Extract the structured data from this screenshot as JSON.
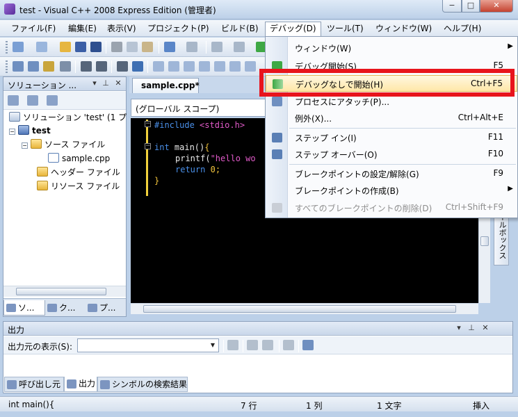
{
  "window": {
    "title": "test - Visual C++ 2008 Express Edition (管理者)",
    "minimize_glyph": "−",
    "maximize_glyph": "□",
    "close_glyph": "✕"
  },
  "menubar": {
    "items": [
      {
        "label": "ファイル(F)"
      },
      {
        "label": "編集(E)"
      },
      {
        "label": "表示(V)"
      },
      {
        "label": "プロジェクト(P)"
      },
      {
        "label": "ビルド(B)"
      },
      {
        "label": "デバッグ(D)"
      },
      {
        "label": "ツール(T)"
      },
      {
        "label": "ウィンドウ(W)"
      },
      {
        "label": "ヘルプ(H)"
      }
    ]
  },
  "solution_explorer": {
    "title": "ソリューション ...",
    "pin_glyph": "▾",
    "autohide_glyph": "⊥",
    "close_glyph": "✕",
    "tree": [
      {
        "label": "ソリューション 'test' (1 プ",
        "icon": "solution-icon"
      },
      {
        "label": "test",
        "icon": "project-icon",
        "bold": true
      },
      {
        "label": "ソース ファイル",
        "icon": "folder-icon"
      },
      {
        "label": "sample.cpp",
        "icon": "cpp-file-icon"
      },
      {
        "label": "ヘッダー ファイル",
        "icon": "folder-icon"
      },
      {
        "label": "リソース ファイル",
        "icon": "folder-icon"
      }
    ],
    "tabs": [
      {
        "label": "ソ..."
      },
      {
        "label": "ク..."
      },
      {
        "label": "プ..."
      }
    ]
  },
  "editor": {
    "tab_label": "sample.cpp*",
    "scope": "(グローバル スコープ)",
    "code": {
      "line1_directive": "#include",
      "line1_header": "<stdio.h>",
      "line3_kw": "int",
      "line3_rest": " main()",
      "line3_brace": "{",
      "line4_call": "printf(",
      "line4_str": "\"hello wo",
      "line5_kw": "return",
      "line5_num": " 0",
      "line5_semi": ";",
      "line6_brace": "}"
    }
  },
  "toolbox": {
    "label": "ールボックス"
  },
  "output": {
    "title": "出力",
    "source_label": "出力元の表示(S):",
    "source_value": "",
    "tabs": [
      {
        "label": "呼び出し元"
      },
      {
        "label": "出力"
      },
      {
        "label": "シンボルの検索結果"
      }
    ]
  },
  "statusbar": {
    "function": "int main(){",
    "line": "7 行",
    "column": "1 列",
    "char": "1 文字",
    "mode": "挿入"
  },
  "debug_menu": {
    "items": [
      {
        "label": "ウィンドウ(W)",
        "shortcut": "",
        "submenu": true
      },
      {
        "label": "デバッグ開始(S)",
        "shortcut": "F5"
      },
      {
        "label": "デバッグなしで開始(H)",
        "shortcut": "Ctrl+F5",
        "highlighted": true
      },
      {
        "label": "プロセスにアタッチ(P)...",
        "shortcut": ""
      },
      {
        "label": "例外(X)...",
        "shortcut": "Ctrl+Alt+E"
      },
      {
        "label": "ステップ イン(I)",
        "shortcut": "F11"
      },
      {
        "label": "ステップ オーバー(O)",
        "shortcut": "F10"
      },
      {
        "label": "ブレークポイントの設定/解除(G)",
        "shortcut": "F9"
      },
      {
        "label": "ブレークポイントの作成(B)",
        "shortcut": "",
        "submenu": true
      },
      {
        "label": "すべてのブレークポイントの削除(D)",
        "shortcut": "Ctrl+Shift+F9",
        "disabled": true
      }
    ],
    "submenu_arrow": "▶"
  },
  "colors": {
    "highlight_box": "#e8141c",
    "code_keyword": "#4a8fe8",
    "code_string": "#e05ac8",
    "code_punctuation": "#f2c43c"
  }
}
